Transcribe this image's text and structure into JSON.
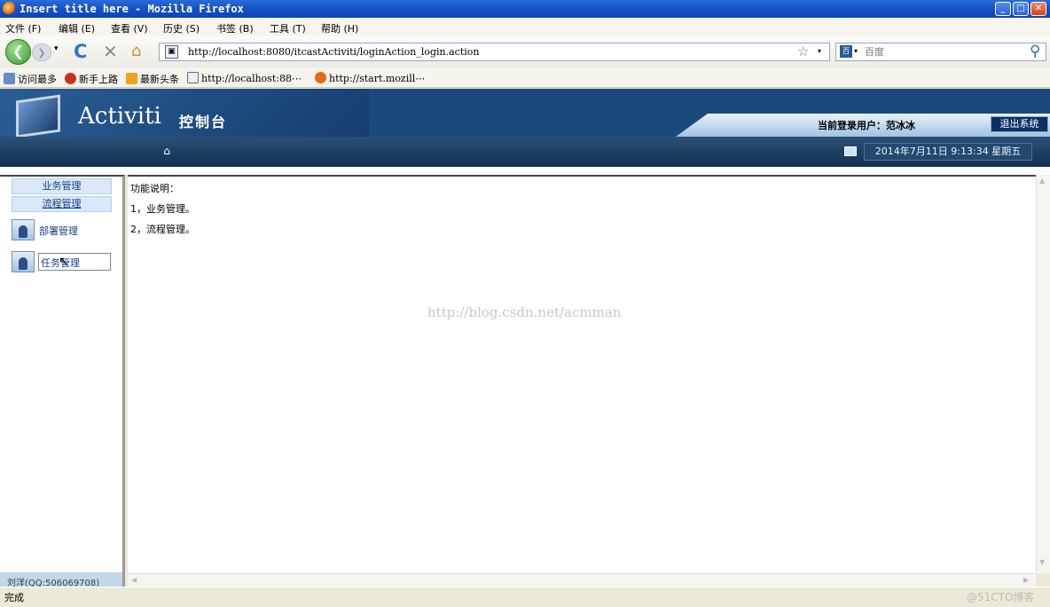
{
  "window": {
    "title": "Insert title here - Mozilla Firefox",
    "min": "_",
    "max": "□",
    "close": "✕"
  },
  "menu": [
    "文件 (F)",
    "编辑 (E)",
    "查看 (V)",
    "历史 (S)",
    "书签 (B)",
    "工具 (T)",
    "帮助 (H)"
  ],
  "nav": {
    "back": "❮",
    "forward": "❯",
    "dropdown": "▾",
    "reload": "C",
    "stop": "✕",
    "home": "⌂",
    "url": "http://localhost:8080/itcastActiviti/loginAction_login.action",
    "star": "☆",
    "url_dropdown": "▾",
    "search_placeholder": "百度",
    "search_engine": "百",
    "search_dropdown": "▾",
    "search_icon": "⚲"
  },
  "bookmarks": [
    "访问最多",
    "新手上路",
    "最新头条",
    "http://localhost:88⋯",
    "http://start.mozill⋯"
  ],
  "app": {
    "logo": "Activiti",
    "logo_sub": "控制台",
    "current_user": "当前登录用户：范冰冰",
    "logout": "退出系统",
    "home_icon": "⌂",
    "datetime": "2014年7月11日 9:13:34 星期五"
  },
  "sidebar": {
    "nav": [
      "业务管理",
      "流程管理"
    ],
    "items": [
      "部署管理",
      "任务管理"
    ],
    "footer": "刘洋(QQ:506069708)",
    "cursor": "↖"
  },
  "content": {
    "lines": [
      "功能说明：",
      "1，业务管理。",
      "2，流程管理。"
    ],
    "watermark": "http://blog.csdn.net/acmman"
  },
  "scroll": {
    "up": "▲",
    "down": "▼",
    "left": "◀",
    "right": "▶"
  },
  "status": {
    "text": "完成",
    "watermark": "@51CTO博客"
  }
}
